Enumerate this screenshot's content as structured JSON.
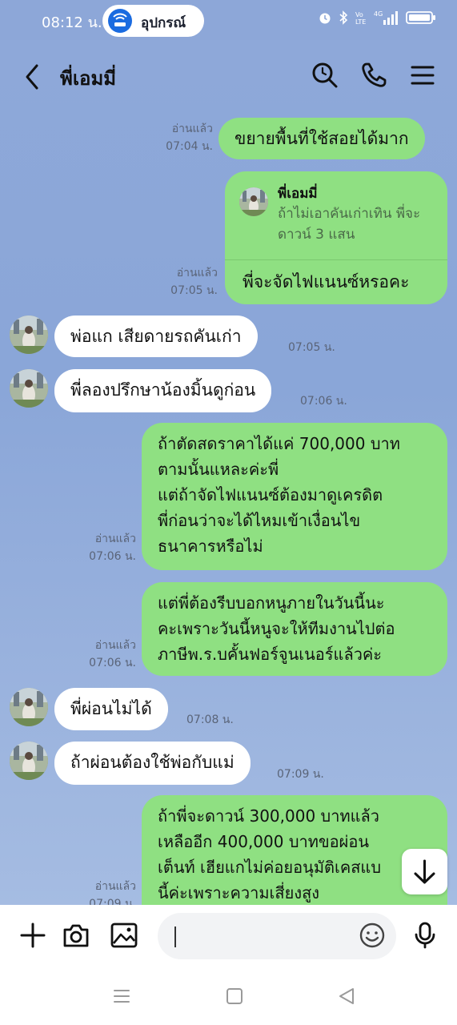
{
  "status_bar": {
    "time": "08:12 น.",
    "pill_label": "อุปกรณ์",
    "pill_icon": "wifi-hotspot-icon",
    "icons": [
      "alarm-icon",
      "bluetooth-icon",
      "volte-icon",
      "4g-signal-icon",
      "battery-icon"
    ]
  },
  "header": {
    "title": "พี่เอมมี่",
    "back_icon": "chevron-left-icon",
    "actions": [
      "search-icon",
      "phone-icon",
      "menu-icon"
    ]
  },
  "messages": [
    {
      "side": "me",
      "text": "ขยายพื้นที่ใช้สอยได้มาก",
      "read": "อ่านแล้ว",
      "time": "07:04 น."
    },
    {
      "side": "me",
      "reply_to_name": "พี่เอมมี่",
      "reply_to_text": "ถ้าไม่เอาคันเก่าเทิน พี่จะดาวน์ 3 แสน",
      "text": "พี่จะจัดไฟแนนซ์หรอคะ",
      "read": "อ่านแล้ว",
      "time": "07:05 น."
    },
    {
      "side": "them",
      "text": "พ่อแก เสียดายรถคันเก่า",
      "time": "07:05 น."
    },
    {
      "side": "them",
      "text": "พี่ลองปรึกษาน้องมิ้นดูก่อน",
      "time": "07:06 น."
    },
    {
      "side": "me",
      "lines": [
        "ถ้าตัดสดราคาได้แค่ 700,000 บาท",
        "ตามนั้นแหละค่ะพี่",
        "แต่ถ้าจัดไฟแนนซ์ต้องมาดูเครดิต",
        "พี่ก่อนว่าจะได้ไหมเข้าเงื่อนไข",
        "ธนาคารหรือไม่"
      ],
      "read": "อ่านแล้ว",
      "time": "07:06 น."
    },
    {
      "side": "me",
      "lines": [
        "แต่พี่ต้องรีบบอกหนูภายในวันนี้นะ",
        "คะเพราะวันนี้หนูจะให้ทีมงานไปต่อ",
        "ภาษีพ.ร.บคั้นฟอร์จูนเนอร์แล้วค่ะ"
      ],
      "read": "อ่านแล้ว",
      "time": "07:06 น."
    },
    {
      "side": "them",
      "text": "พี่ผ่อนไม่ได้",
      "time": "07:08 น."
    },
    {
      "side": "them",
      "text": "ถ้าผ่อนต้องใช้พ่อกับแม่",
      "time": "07:09 น."
    },
    {
      "side": "me",
      "lines": [
        "ถ้าพี่จะดาวน์ 300,000 บาทแล้ว",
        "เหลืออีก 400,000 บาทขอผ่อน",
        "เต็นท์ เฮียแกไม่ค่อยอนุมัติเคสแบ",
        "นี้ค่ะเพราะความเสี่ยงสูง"
      ],
      "read": "อ่านแล้ว",
      "time": "07:09 น."
    }
  ],
  "scroll_button_icon": "arrow-down-icon",
  "input_bar": {
    "icons": [
      "plus-icon",
      "camera-icon",
      "image-icon",
      "emoji-icon",
      "microphone-icon"
    ],
    "placeholder": ""
  },
  "nav_bar": {
    "icons": [
      "recent-apps-icon",
      "home-icon",
      "back-icon"
    ]
  },
  "colors": {
    "chat_background": "#8ea8d9",
    "my_bubble": "#8fe082",
    "their_bubble": "#ffffff",
    "accent": "#1a6be0"
  }
}
